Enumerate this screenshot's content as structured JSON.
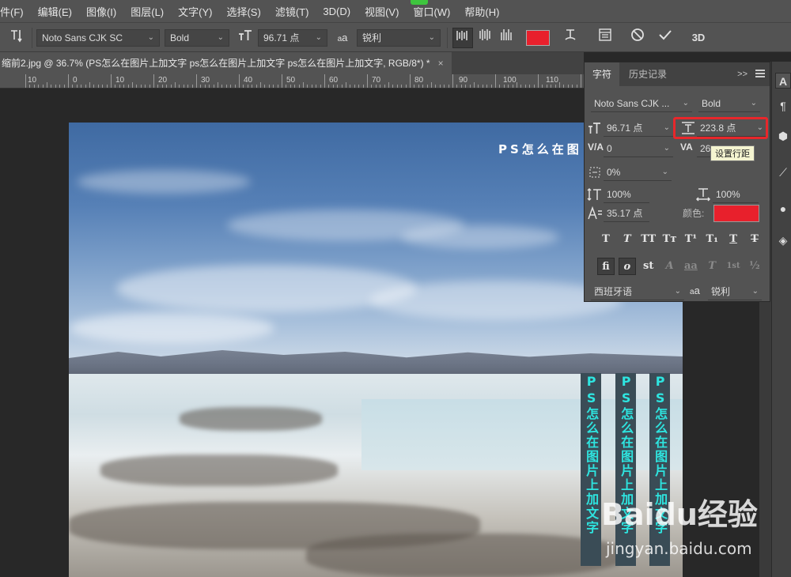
{
  "menu": [
    "件(F)",
    "编辑(E)",
    "图像(I)",
    "图层(L)",
    "文字(Y)",
    "选择(S)",
    "滤镜(T)",
    "3D(D)",
    "视图(V)",
    "窗口(W)",
    "帮助(H)"
  ],
  "options": {
    "tool_icon": "text-orientation-icon",
    "font_family": "Noto Sans CJK SC",
    "font_style": "Bold",
    "font_size": "96.71 点",
    "aa_label": "a",
    "antialias": "锐利",
    "text_color": "#e8202c"
  },
  "document_tab": {
    "title": "缩前2.jpg @ 36.7% (PS怎么在图片上加文字 ps怎么在图片上加文字 ps怎么在图片上加文字, RGB/8*) *",
    "close": "×"
  },
  "ruler_labels": [
    "10",
    "0",
    "10",
    "20",
    "30",
    "40",
    "50",
    "60",
    "70",
    "80",
    "90",
    "100",
    "110"
  ],
  "canvas": {
    "title_text": "PS怎么在图",
    "vertical_columns": [
      {
        "text": "PS怎么在图片上加文字"
      },
      {
        "text": "PS怎么在图片上加文字"
      },
      {
        "text": "PS怎么在图片上加文字"
      }
    ]
  },
  "watermark": {
    "logo": "Baidu经验",
    "sub": "jingyan.baidu.com"
  },
  "panel": {
    "tab_character": "字符",
    "tab_history": "历史记录",
    "collapse": ">>",
    "font_family": "Noto Sans CJK ...",
    "font_style": "Bold",
    "font_size": "96.71 点",
    "leading": "223.8 点",
    "kerning": "0",
    "tracking": "26",
    "tsume": "0%",
    "vscale": "100%",
    "hscale": "100%",
    "baseline": "35.17 点",
    "color_label": "颜色:",
    "color": "#e8202c",
    "tooltip": "设置行距",
    "language": "西班牙语",
    "aa_label": "a",
    "antialias": "锐利"
  },
  "style_buttons_row1": [
    "T",
    "T",
    "TT",
    "Tт",
    "T¹",
    "T₁",
    "T",
    "T"
  ],
  "style_buttons_row2": [
    "fi",
    "o",
    "st",
    "A",
    "aa",
    "T",
    "1st",
    "½"
  ]
}
